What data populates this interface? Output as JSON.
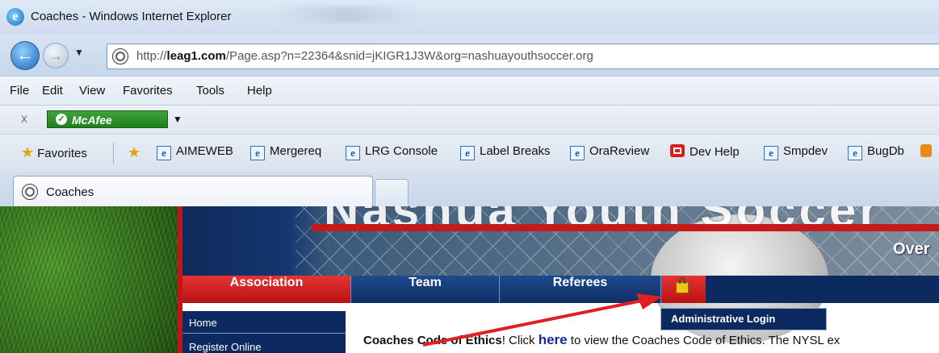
{
  "window": {
    "title": "Coaches - Windows Internet Explorer"
  },
  "address_bar": {
    "url_prefix": "http://",
    "url_domain": "leag1.com",
    "url_path": "/Page.asp?n=22364&snid=jKIGR1J3W&org=nashuayouthsoccer.org"
  },
  "menu": [
    "File",
    "Edit",
    "View",
    "Favorites",
    "Tools",
    "Help"
  ],
  "toolbar": {
    "close_label": "x",
    "mcafee_label": "McAfee"
  },
  "favorites": {
    "favorites_label": "Favorites",
    "items": [
      "AIMEWEB",
      "Mergereq",
      "LRG Console",
      "Label Breaks",
      "OraReview",
      "Dev Help",
      "Smpdev",
      "BugDb"
    ]
  },
  "tabs": [
    {
      "label": "Coaches"
    }
  ],
  "page": {
    "banner_title": "Nashua Youth Soccer",
    "banner_tagline": "Over",
    "nav": {
      "association": "Association",
      "team": "Team",
      "referees": "Referees"
    },
    "dropdown_item": "Administrative Login",
    "sidebar": [
      "Home",
      "Register Online"
    ],
    "body_text": {
      "bold_lead": "Coaches Code of Ethics",
      "excl": "! Click ",
      "link": "here",
      "rest": " to view the Coaches Code of Ethics. The NYSL ex"
    }
  },
  "colors": {
    "accent_red": "#c21616",
    "nav_blue": "#0d2a60",
    "annotation_arrow": "#e02020"
  },
  "icons": [
    "ie-logo-icon",
    "back-arrow-icon",
    "forward-arrow-icon",
    "soccer-ball-icon",
    "mcafee-shield-icon",
    "favorites-star-icon",
    "add-favorite-icon",
    "ie-page-icon",
    "dev-help-icon",
    "lock-icon"
  ]
}
